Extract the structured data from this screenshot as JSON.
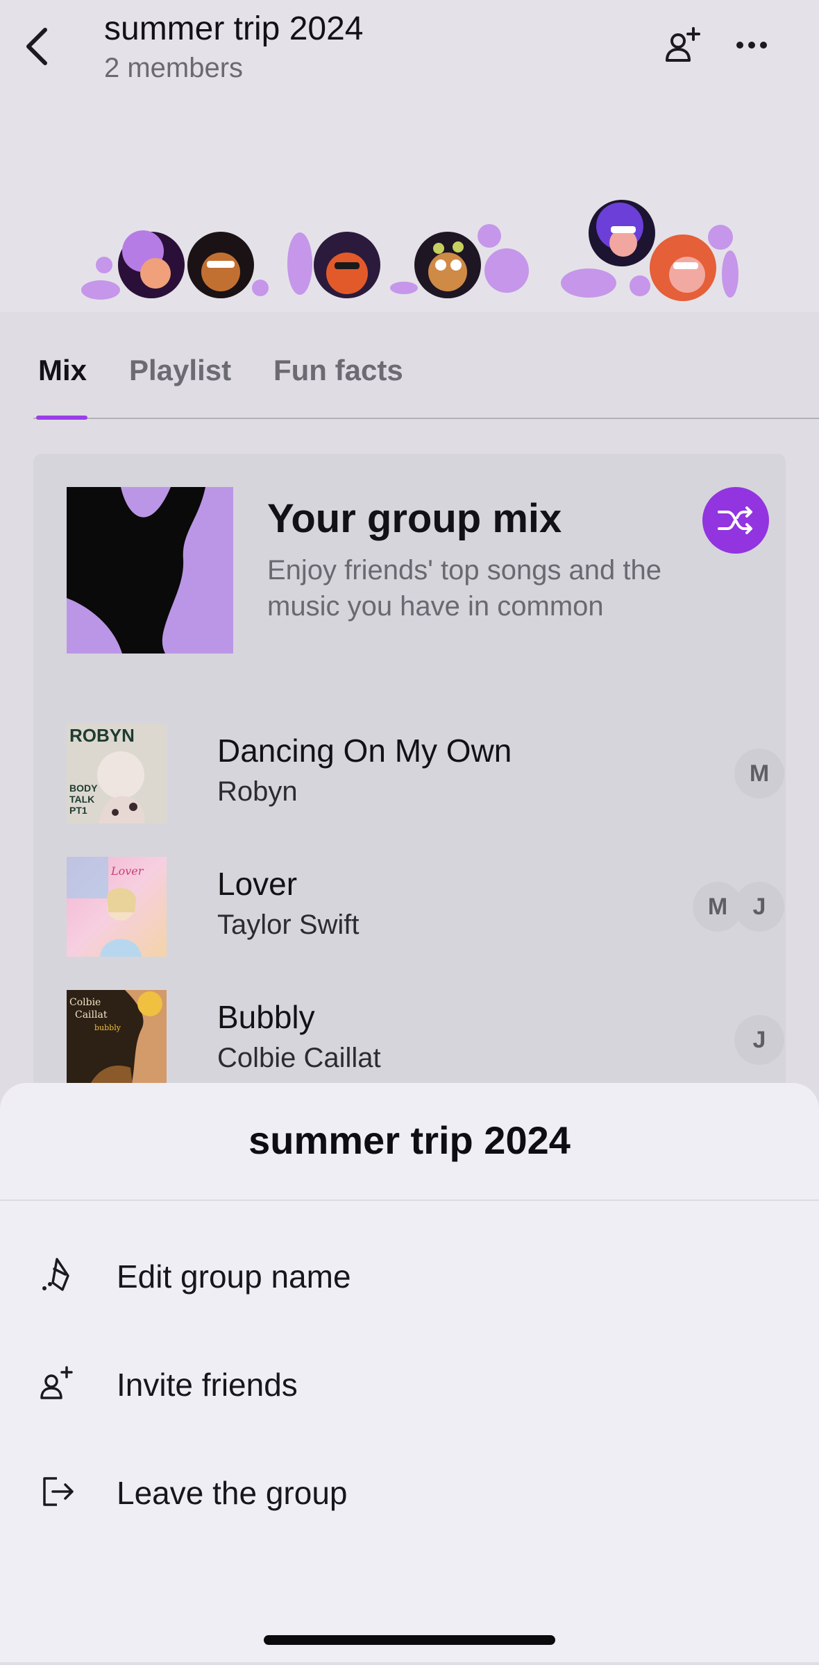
{
  "header": {
    "title": "summer trip 2024",
    "member_count": "2 members",
    "back_icon": "chevron-left-icon",
    "add_member_icon": "person-add-icon",
    "more_icon": "more-horizontal-icon"
  },
  "tabs": [
    {
      "label": "Mix",
      "active": true
    },
    {
      "label": "Playlist",
      "active": false
    },
    {
      "label": "Fun facts",
      "active": false
    }
  ],
  "mix": {
    "title": "Your group mix",
    "description": "Enjoy friends' top songs and the music you have in common",
    "shuffle_icon": "shuffle-icon"
  },
  "tracks": [
    {
      "title": "Dancing On My Own",
      "artist": "Robyn",
      "members": [
        "M"
      ],
      "art_text": "ROBYN",
      "art_subtext": "BODY TALK PT1"
    },
    {
      "title": "Lover",
      "artist": "Taylor Swift",
      "members": [
        "M",
        "J"
      ],
      "art_text": "Lover",
      "art_subtext": ""
    },
    {
      "title": "Bubbly",
      "artist": "Colbie Caillat",
      "members": [
        "J"
      ],
      "art_text": "Colbie Caillat",
      "art_subtext": "bubbly"
    }
  ],
  "sheet": {
    "title": "summer trip 2024",
    "items": [
      {
        "label": "Edit group name",
        "icon": "pencil-icon"
      },
      {
        "label": "Invite friends",
        "icon": "person-add-icon"
      },
      {
        "label": "Leave the group",
        "icon": "exit-icon"
      }
    ]
  },
  "colors": {
    "accent": "#9234e0",
    "mix_art": "#bb96e6",
    "tab_underline": "#9b3fe8"
  }
}
